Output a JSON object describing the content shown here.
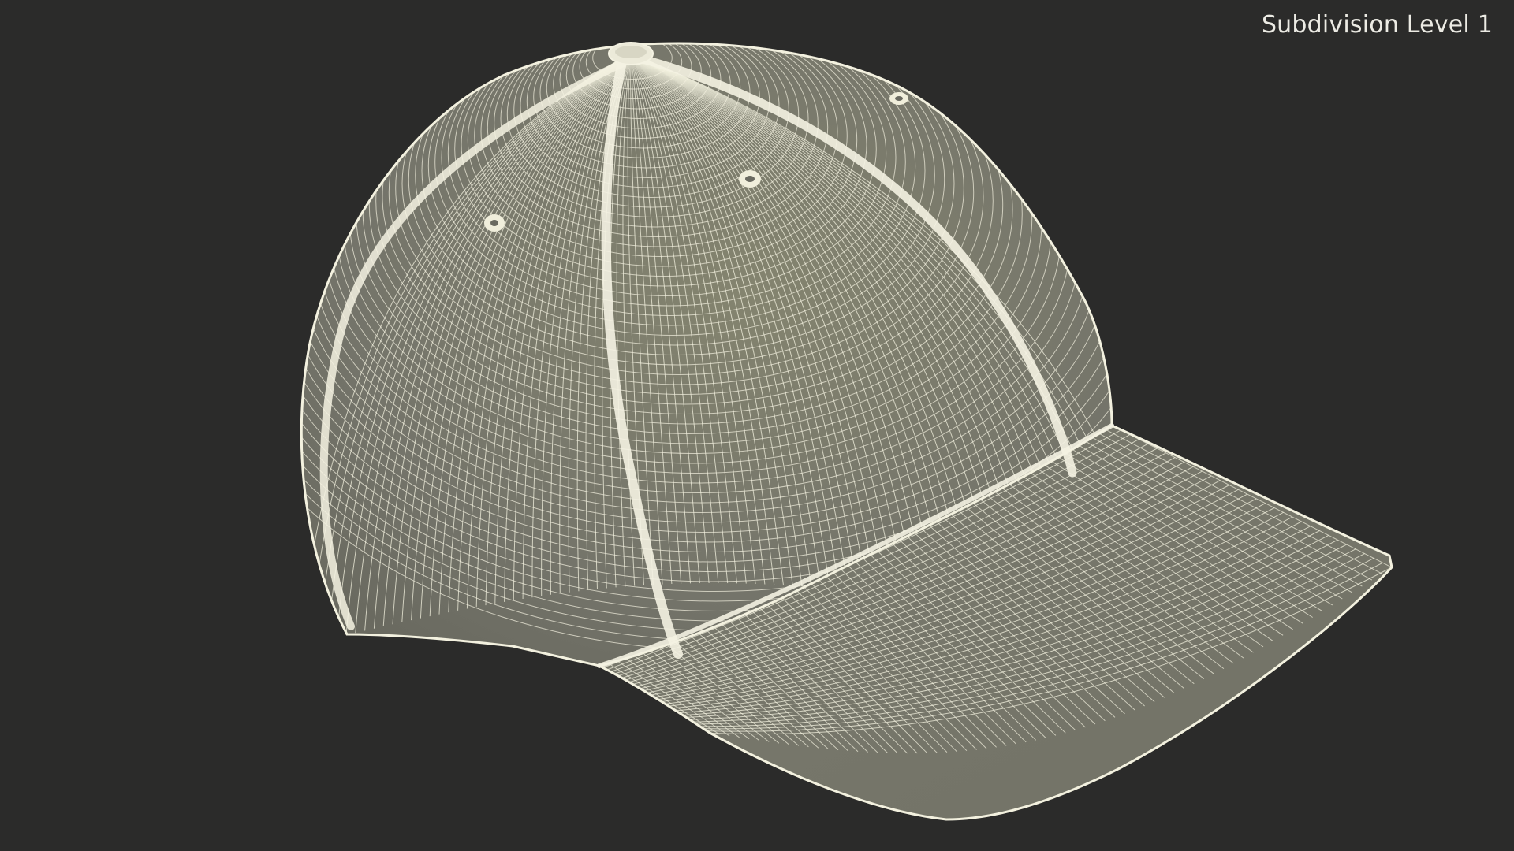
{
  "viewport": {
    "subdivision_label": "Subdivision Level 1",
    "background_color": "#2b2b2a"
  },
  "model": {
    "subject": "baseball-cap",
    "render_style": "wireframe",
    "surface_color": "#7a7a6c",
    "wire_color": "#f3f1df"
  }
}
